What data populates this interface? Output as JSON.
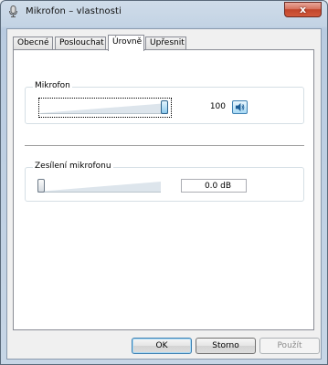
{
  "window": {
    "title": "Mikrofon – vlastnosti",
    "close_glyph": "x",
    "app_icon": "microphone-icon"
  },
  "tabs": [
    {
      "label": "Obecné",
      "active": false
    },
    {
      "label": "Poslouchat",
      "active": false
    },
    {
      "label": "Úrovně",
      "active": true
    },
    {
      "label": "Upřesnit",
      "active": false
    }
  ],
  "levels": {
    "microphone": {
      "label": "Mikrofon",
      "value": "100",
      "level_percent": 100,
      "mute_icon": "speaker-icon"
    },
    "boost": {
      "label": "Zesílení mikrofonu",
      "value": "0.0 dB",
      "level_percent": 0
    }
  },
  "buttons": {
    "ok": "OK",
    "cancel": "Storno",
    "apply": "Použít"
  },
  "colors": {
    "accent": "#3c7fb1",
    "close": "#c1452b"
  }
}
